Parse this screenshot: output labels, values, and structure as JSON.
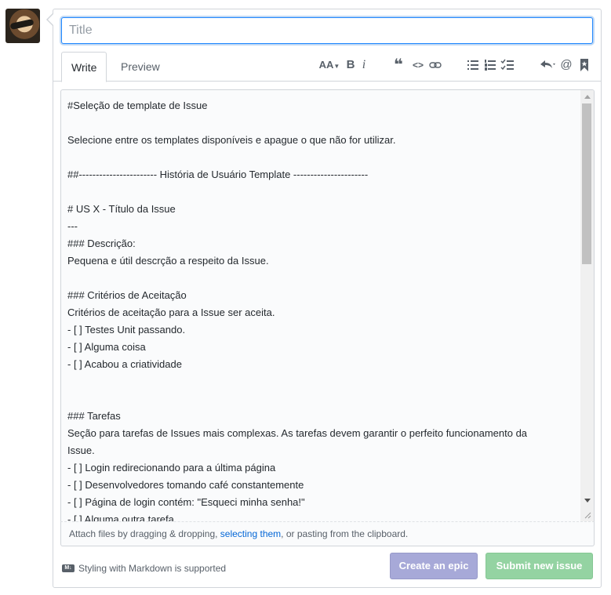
{
  "title_input": {
    "placeholder": "Title",
    "value": ""
  },
  "tabs": {
    "write": "Write",
    "preview": "Preview"
  },
  "toolbar": {
    "header": "AA",
    "bold": "B",
    "italic": "i",
    "quote": "❝",
    "code": "<>",
    "mention": "@"
  },
  "editor": {
    "lines": [
      "#Seleção de template de Issue",
      "",
      "Selecione entre os templates disponíveis e apague o que não for utilizar.",
      "",
      "##----------------------- História de Usuário Template ----------------------",
      "",
      "# US X - Título da Issue",
      "---",
      "### Descrição:",
      "Pequena e útil descrção a respeito da Issue.",
      "",
      "### Critérios de Aceitação",
      "Critérios de aceitação para a Issue ser aceita.",
      "- [ ] Testes Unit passando.",
      "- [ ] Alguma coisa",
      "- [ ] Acabou a criatividade",
      "",
      "",
      "### Tarefas",
      "Seção para tarefas de Issues mais complexas. As tarefas devem garantir o perfeito funcionamento da",
      "Issue.",
      "- [ ] Login redirecionando para a última página",
      "- [ ] Desenvolvedores tomando café constantemente",
      "- [ ] Página de login contém: \"Esqueci minha senha!\"",
      "- [ ] Alguma outra tarefa"
    ]
  },
  "attach": {
    "before": "Attach files by dragging & dropping, ",
    "link": "selecting them",
    "after": ", or pasting from the clipboard."
  },
  "markdown_note": {
    "badge": "M↓",
    "text": "Styling with Markdown is supported"
  },
  "buttons": {
    "epic": "Create an epic",
    "submit": "Submit new issue"
  },
  "colors": {
    "accent": "#2188ff",
    "epic": "#a7a9d8",
    "submit": "#94d3a2",
    "link": "#0366d6"
  }
}
